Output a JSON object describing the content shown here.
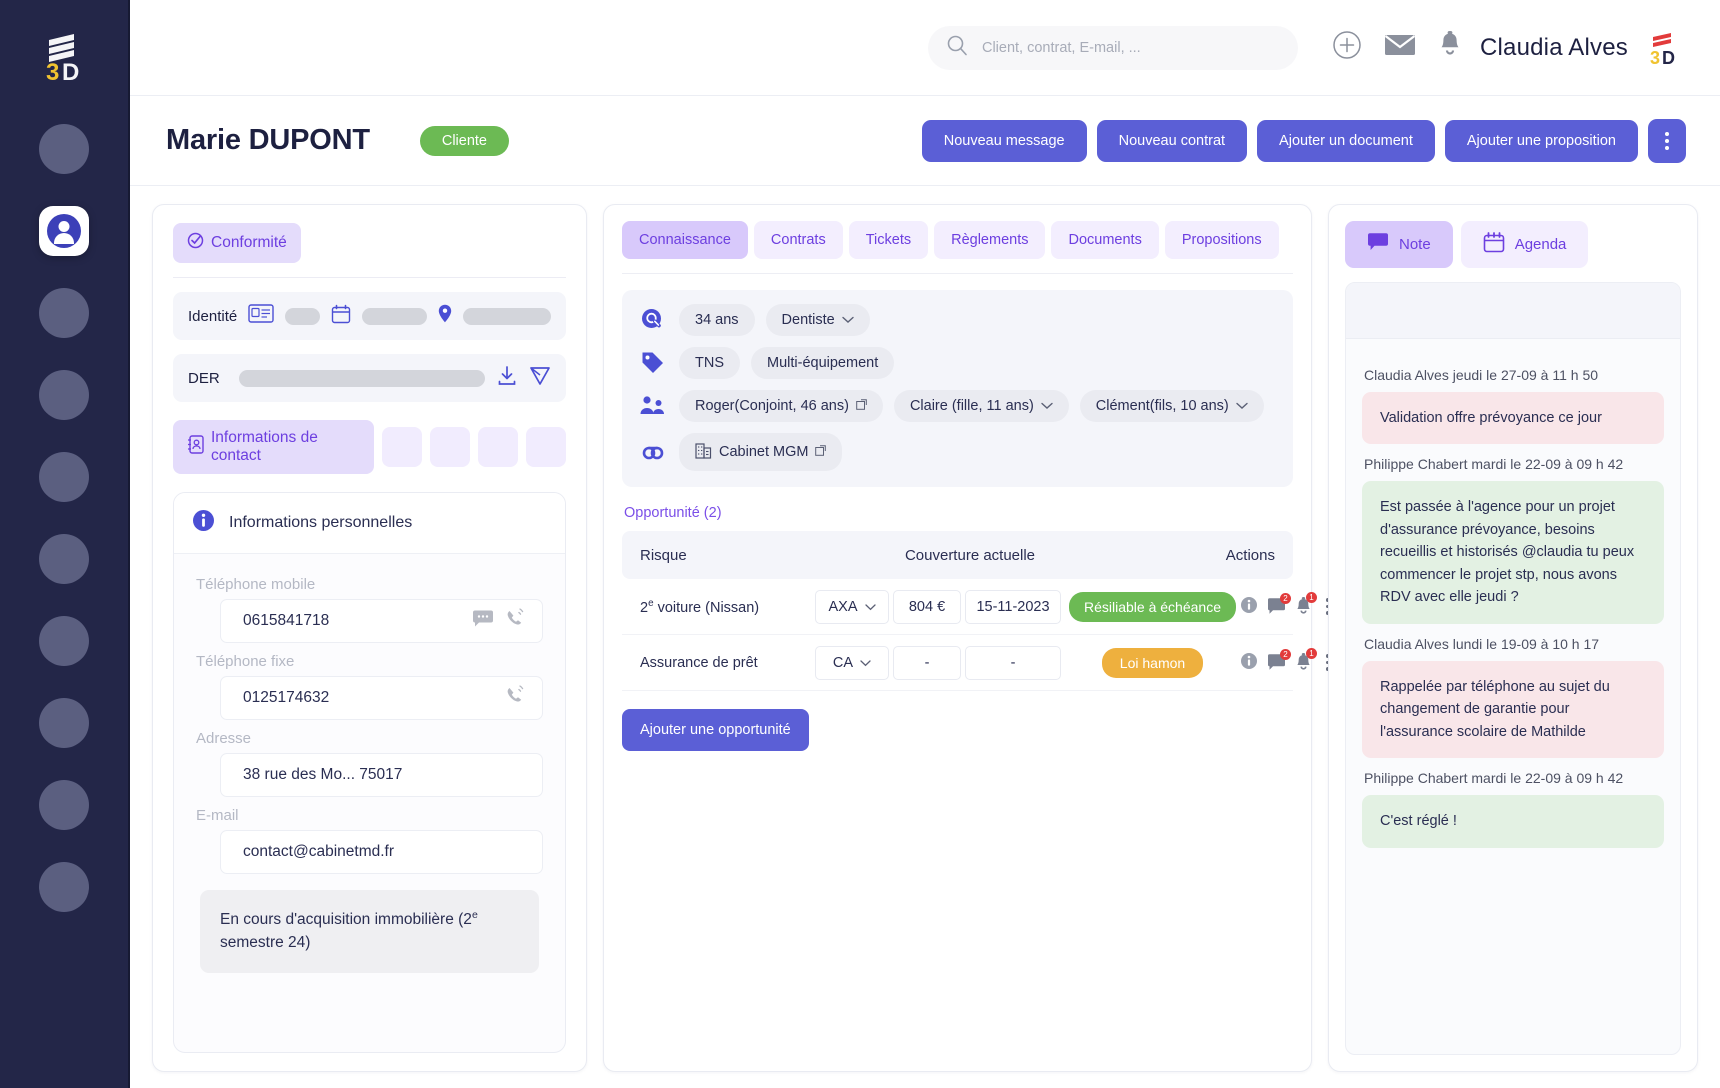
{
  "colors": {
    "rail_bg": "#232648",
    "primary": "#5b5fd6",
    "accent_purple": "#6d3fe0",
    "green": "#6cba54",
    "amber": "#eeb03e",
    "pink_note": "#f9e6e9",
    "green_note": "#e3f1e3"
  },
  "topbar": {
    "search_placeholder": "Client, contrat, E-mail, ...",
    "search_value": "",
    "search_icon": "search-icon",
    "add_icon": "plus-circle-icon",
    "mail_icon": "envelope-icon",
    "bell_icon": "bell-icon",
    "user_name": "Claudia Alves",
    "brand_logo": "3d-logo-icon"
  },
  "pagehead": {
    "client_name": "Marie DUPONT",
    "status_badge": "Cliente",
    "buttons": [
      "Nouveau message",
      "Nouveau contrat",
      "Ajouter un document",
      "Ajouter une proposition"
    ],
    "more_icon": "kebab-menu-icon"
  },
  "left_panel": {
    "conformity_label": "Conformité",
    "conformity_icon": "check-circle-icon",
    "identity_label": "Identité",
    "identity_icons": [
      "id-card-icon",
      "calendar-icon",
      "location-pin-icon"
    ],
    "der_label": "DER",
    "der_icons": [
      "download-icon",
      "send-icon"
    ],
    "contact_info_label": "Informations de contact",
    "contact_info_icon": "address-book-icon",
    "personal_info_title": "Informations personnelles",
    "personal_info_icon": "info-icon",
    "fields": [
      {
        "label": "Téléphone mobile",
        "value": "0615841718",
        "icons": [
          "sms-icon",
          "phone-icon"
        ]
      },
      {
        "label": "Téléphone fixe",
        "value": "0125174632",
        "icons": [
          "phone-icon"
        ]
      },
      {
        "label": "Adresse",
        "value": "38 rue des Mo... 75017",
        "icons": []
      },
      {
        "label": "E-mail",
        "value": "contact@cabinetmd.fr",
        "icons": []
      }
    ],
    "footer_note": "En cours d'acquisition immobilière (2e semestre 24)",
    "footer_note_line1": "En cours d'acquisition immobilière (2",
    "footer_note_sup": "e",
    "footer_note_line2": "semestre 24)"
  },
  "center_panel": {
    "tabs": [
      {
        "label": "Connaissance",
        "active": true
      },
      {
        "label": "Contrats",
        "active": false
      },
      {
        "label": "Tickets",
        "active": false
      },
      {
        "label": "Règlements",
        "active": false
      },
      {
        "label": "Documents",
        "active": false
      },
      {
        "label": "Propositions",
        "active": false
      }
    ],
    "info_rows": [
      {
        "icon": "magnifier-badge-icon",
        "chips": [
          {
            "text": "34 ans",
            "dropdown": false,
            "external": false
          },
          {
            "text": "Dentiste",
            "dropdown": true,
            "external": false
          }
        ]
      },
      {
        "icon": "tag-icon",
        "chips": [
          {
            "text": "TNS",
            "dropdown": false,
            "external": false
          },
          {
            "text": "Multi-équipement",
            "dropdown": false,
            "external": false
          }
        ]
      },
      {
        "icon": "family-icon",
        "chips": [
          {
            "text": "Roger(Conjoint, 46 ans)",
            "dropdown": false,
            "external": true
          },
          {
            "text": "Claire (fille, 11 ans)",
            "dropdown": true,
            "external": false
          },
          {
            "text": "Clément(fils, 10 ans)",
            "dropdown": true,
            "external": false
          }
        ]
      },
      {
        "icon": "link-icon",
        "chips": [
          {
            "text": "Cabinet MGM",
            "dropdown": false,
            "external": true,
            "lead_icon": "building-icon"
          }
        ]
      }
    ],
    "opportunity_title": "Opportunité (2)",
    "table_headers": {
      "risk": "Risque",
      "coverage": "Couverture actuelle",
      "actions": "Actions"
    },
    "rows": [
      {
        "risk_prefix": "2",
        "risk_sup": "e",
        "risk_rest": " voiture (Nissan)",
        "risk_full": "2e voiture (Nissan)",
        "insurer": "AXA",
        "amount": "804 €",
        "date": "15-11-2023",
        "status": "Résiliable à échéance",
        "status_color": "green",
        "action_icons": [
          "info-icon",
          "note-icon",
          "bell-icon",
          "kebab-menu-icon"
        ],
        "note_badge": "2",
        "bell_badge": "1"
      },
      {
        "risk_prefix": "",
        "risk_sup": "",
        "risk_rest": "Assurance de prêt",
        "risk_full": "Assurance de prêt",
        "insurer": "CA",
        "amount": "-",
        "date": "-",
        "status": "Loi hamon",
        "status_color": "amber",
        "action_icons": [
          "info-icon",
          "note-icon",
          "bell-icon",
          "kebab-menu-icon"
        ],
        "note_badge": "2",
        "bell_badge": "1"
      }
    ],
    "add_opportunity_label": "Ajouter une opportunité"
  },
  "right_panel": {
    "tabs": [
      {
        "label": "Note",
        "icon": "speech-bubble-icon",
        "active": true
      },
      {
        "label": "Agenda",
        "icon": "calendar-icon",
        "active": false
      }
    ],
    "notes": [
      {
        "meta": "Claudia Alves jeudi le 27-09 à 11 h 50",
        "text": "Validation offre prévoyance ce jour",
        "color": "pink"
      },
      {
        "meta": "Philippe Chabert mardi le 22-09 à 09 h 42",
        "text": "Est passée à l'agence pour un projet d'assurance prévoyance, besoins recueillis et historisés @claudia tu peux commencer le projet stp, nous avons RDV avec elle jeudi  ?",
        "color": "green"
      },
      {
        "meta": "Claudia Alves lundi le 19-09 à 10 h 17",
        "text": "Rappelée par téléphone au sujet du changement de garantie pour l'assurance scolaire de Mathilde",
        "color": "pink"
      },
      {
        "meta": "Philippe Chabert mardi le 22-09 à 09 h 42",
        "text": "C'est réglé !",
        "color": "green"
      }
    ]
  }
}
